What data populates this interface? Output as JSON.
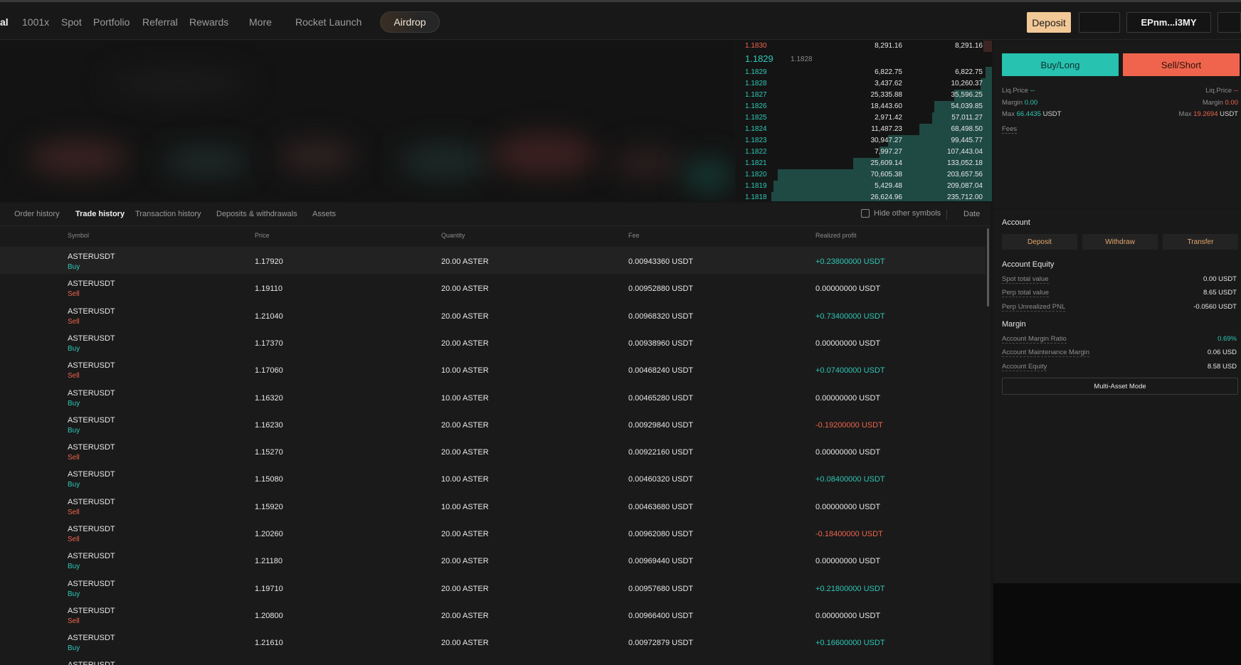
{
  "nav": {
    "items": [
      "al",
      "1001x",
      "Spot",
      "Portfolio",
      "Referral",
      "Rewards",
      "More",
      "Rocket Launch"
    ],
    "airdrop": "Airdrop",
    "deposit": "Deposit",
    "wallet": "EPnm...i3MY"
  },
  "orderbook": {
    "top_ask": {
      "price": "1.1830",
      "size": "8,291.16",
      "total": "8,291.16",
      "depth": 0.04
    },
    "mid_price": "1.1829",
    "mark_price": "1.1828",
    "bids": [
      {
        "price": "1.1829",
        "size": "6,822.75",
        "total": "6,822.75",
        "depth": 0.03
      },
      {
        "price": "1.1828",
        "size": "3,437.62",
        "total": "10,260.37",
        "depth": 0.05
      },
      {
        "price": "1.1827",
        "size": "25,335.88",
        "total": "35,596.25",
        "depth": 0.17
      },
      {
        "price": "1.1826",
        "size": "18,443.60",
        "total": "54,039.85",
        "depth": 0.26
      },
      {
        "price": "1.1825",
        "size": "2,971.42",
        "total": "57,011.27",
        "depth": 0.27
      },
      {
        "price": "1.1824",
        "size": "11,487.23",
        "total": "68,498.50",
        "depth": 0.33
      },
      {
        "price": "1.1823",
        "size": "30,947.27",
        "total": "99,445.77",
        "depth": 0.47
      },
      {
        "price": "1.1822",
        "size": "7,997.27",
        "total": "107,443.04",
        "depth": 0.51
      },
      {
        "price": "1.1821",
        "size": "25,609.14",
        "total": "133,052.18",
        "depth": 0.63
      },
      {
        "price": "1.1820",
        "size": "70,605.38",
        "total": "203,657.56",
        "depth": 0.97
      },
      {
        "price": "1.1819",
        "size": "5,429.48",
        "total": "209,087.04",
        "depth": 0.99
      },
      {
        "price": "1.1818",
        "size": "26,624.96",
        "total": "235,712.00",
        "depth": 1.0
      }
    ]
  },
  "trade": {
    "buy_long": "Buy/Long",
    "sell_short": "Sell/Short",
    "liq_label": "Liq.Price",
    "liq_left": "--",
    "liq_right": "--",
    "margin_label": "Margin",
    "margin_left": "0.00",
    "margin_right": "0.00",
    "max_label": "Max",
    "max_left": "66.4435",
    "max_right": "19.2694",
    "unit": "USDT",
    "fees": "Fees"
  },
  "account": {
    "title": "Account",
    "buttons": [
      "Deposit",
      "Withdraw",
      "Transfer"
    ],
    "equity_title": "Account Equity",
    "equity_rows": [
      {
        "label": "Spot total value",
        "value": "0.00 USDT"
      },
      {
        "label": "Perp total value",
        "value": "8.65 USDT"
      },
      {
        "label": "Perp Unrealized PNL",
        "value": "-0.0560 USDT"
      }
    ],
    "margin_title": "Margin",
    "margin_rows": [
      {
        "label": "Account Margin Ratio",
        "value": "0.69%"
      },
      {
        "label": "Account Maintenance Margin",
        "value": "0.06 USD"
      },
      {
        "label": "Account Equity",
        "value": "8.58 USD"
      }
    ],
    "multi_asset": "Multi-Asset Mode"
  },
  "history": {
    "tabs": [
      "Order history",
      "Trade history",
      "Transaction history",
      "Deposits & withdrawals",
      "Assets"
    ],
    "hide_other": "Hide other symbols",
    "date": "Date",
    "columns": [
      "Symbol",
      "Price",
      "Quantity",
      "Fee",
      "Realized profit"
    ],
    "rows": [
      {
        "symbol": "ASTERUSDT",
        "side": "Buy",
        "price": "1.17920",
        "qty": "20.00 ASTER",
        "fee": "0.00943360 USDT",
        "pnl": "+0.23800000 USDT"
      },
      {
        "symbol": "ASTERUSDT",
        "side": "Sell",
        "price": "1.19110",
        "qty": "20.00 ASTER",
        "fee": "0.00952880 USDT",
        "pnl": "0.00000000 USDT"
      },
      {
        "symbol": "ASTERUSDT",
        "side": "Sell",
        "price": "1.21040",
        "qty": "20.00 ASTER",
        "fee": "0.00968320 USDT",
        "pnl": "+0.73400000 USDT"
      },
      {
        "symbol": "ASTERUSDT",
        "side": "Buy",
        "price": "1.17370",
        "qty": "20.00 ASTER",
        "fee": "0.00938960 USDT",
        "pnl": "0.00000000 USDT"
      },
      {
        "symbol": "ASTERUSDT",
        "side": "Sell",
        "price": "1.17060",
        "qty": "10.00 ASTER",
        "fee": "0.00468240 USDT",
        "pnl": "+0.07400000 USDT"
      },
      {
        "symbol": "ASTERUSDT",
        "side": "Buy",
        "price": "1.16320",
        "qty": "10.00 ASTER",
        "fee": "0.00465280 USDT",
        "pnl": "0.00000000 USDT"
      },
      {
        "symbol": "ASTERUSDT",
        "side": "Buy",
        "price": "1.16230",
        "qty": "20.00 ASTER",
        "fee": "0.00929840 USDT",
        "pnl": "-0.19200000 USDT"
      },
      {
        "symbol": "ASTERUSDT",
        "side": "Sell",
        "price": "1.15270",
        "qty": "20.00 ASTER",
        "fee": "0.00922160 USDT",
        "pnl": "0.00000000 USDT"
      },
      {
        "symbol": "ASTERUSDT",
        "side": "Buy",
        "price": "1.15080",
        "qty": "10.00 ASTER",
        "fee": "0.00460320 USDT",
        "pnl": "+0.08400000 USDT"
      },
      {
        "symbol": "ASTERUSDT",
        "side": "Sell",
        "price": "1.15920",
        "qty": "10.00 ASTER",
        "fee": "0.00463680 USDT",
        "pnl": "0.00000000 USDT"
      },
      {
        "symbol": "ASTERUSDT",
        "side": "Sell",
        "price": "1.20260",
        "qty": "20.00 ASTER",
        "fee": "0.00962080 USDT",
        "pnl": "-0.18400000 USDT"
      },
      {
        "symbol": "ASTERUSDT",
        "side": "Buy",
        "price": "1.21180",
        "qty": "20.00 ASTER",
        "fee": "0.00969440 USDT",
        "pnl": "0.00000000 USDT"
      },
      {
        "symbol": "ASTERUSDT",
        "side": "Buy",
        "price": "1.19710",
        "qty": "20.00 ASTER",
        "fee": "0.00957680 USDT",
        "pnl": "+0.21800000 USDT"
      },
      {
        "symbol": "ASTERUSDT",
        "side": "Sell",
        "price": "1.20800",
        "qty": "20.00 ASTER",
        "fee": "0.00966400 USDT",
        "pnl": "0.00000000 USDT"
      },
      {
        "symbol": "ASTERUSDT",
        "side": "Buy",
        "price": "1.21610",
        "qty": "20.00 ASTER",
        "fee": "0.00972879 USDT",
        "pnl": "+0.16600000 USDT"
      }
    ],
    "partial_symbol": "ASTERUSDT"
  },
  "colors": {
    "accent": "#f2c896",
    "buy": "#2ec7b6",
    "sell": "#f0644d",
    "background": "#161616"
  }
}
